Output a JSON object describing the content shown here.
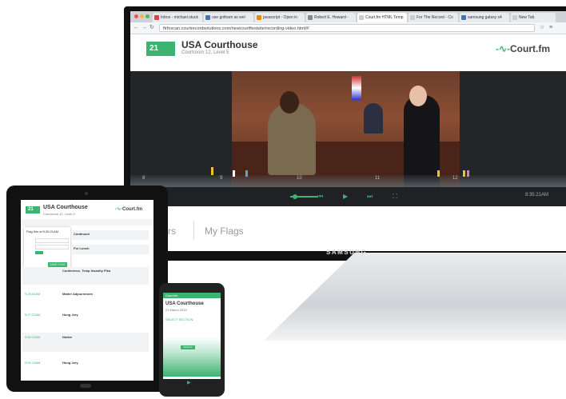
{
  "browser": {
    "tabs": [
      {
        "label": "Inbox - michael.stuck",
        "fav": "#d44"
      },
      {
        "label": "use gotham as wel",
        "fav": "#47a"
      },
      {
        "label": "javascript - Open in",
        "fav": "#e80"
      },
      {
        "label": "Robert E. Howard -",
        "fav": "#888"
      },
      {
        "label": "Court.fm HTML Temp",
        "fav": "#ccc"
      },
      {
        "label": "For The Record - Co",
        "fav": "#ccc"
      },
      {
        "label": "samsung galaxy s4",
        "fav": "#47a"
      },
      {
        "label": "New Tab",
        "fav": "#ccc"
      }
    ],
    "url": "ftrfoxcan.courtrecordsolutions.com/newcourtftestsite/recording-video.html#!"
  },
  "app": {
    "badge": "21",
    "title": "USA Courthouse",
    "subtitle": "Courtroom 12, Level 5",
    "brand": "Court.fm",
    "timestamp": "8:35:21AM",
    "tabs": [
      "ters",
      "My Flags"
    ],
    "timeline_marks": [
      "8",
      "9",
      "10",
      "11",
      "12"
    ]
  },
  "monitor": {
    "brand": "SAMSUNG"
  },
  "tablet": {
    "badge": "21",
    "title": "USA Courthouse",
    "subtitle": "Courtroom 12, Level 5",
    "brand": "Court.fm",
    "popup_title": "Flag this at 8:35:21AM",
    "popup_button": "SAVE FLAG",
    "events": [
      {
        "time": "",
        "title": "Continued"
      },
      {
        "time": "",
        "title": "For Lunch"
      },
      {
        "time": "",
        "title": "Conference, Temp Insanity Plea"
      },
      {
        "time": "9:25:03AM",
        "title": "Matter Adjournment"
      },
      {
        "time": "9:27:22AM",
        "title": "Hung Jury"
      },
      {
        "time": "9:50:12AM",
        "title": "Notice"
      },
      {
        "time": "9:51:13AM",
        "title": "Hung Jury"
      }
    ],
    "colors": {
      "accent": "#3cb371"
    }
  },
  "phone": {
    "header": "Court.fm",
    "title": "USA Courthouse",
    "subtitle": "21 March 2015",
    "link": "SELECT SECTION",
    "marker": "10:32:21"
  },
  "colors": {
    "accent": "#3cb371",
    "dark": "#1f2124"
  }
}
